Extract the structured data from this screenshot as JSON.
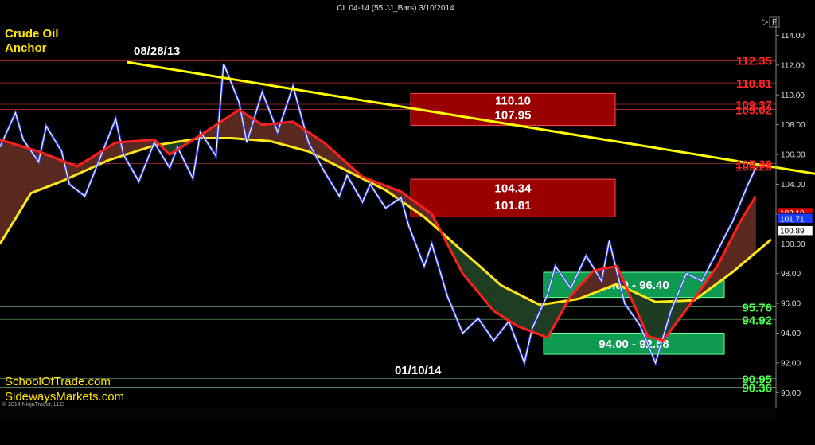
{
  "window": {
    "title": "CL 04-14 (55 JJ_Bars)  3/10/2014",
    "copyright": "© 2014 NinjaTrader, LLC",
    "menu_glyphs": [
      "▷|",
      "F"
    ]
  },
  "overlay": {
    "heading_line1": "Crude Oil",
    "heading_line2": "Anchor",
    "anchor_date": "08/28/13",
    "low_date": "01/10/14",
    "site1": "SchoolOfTrade.com",
    "site2": "SidewaysMarkets.com"
  },
  "colors": {
    "background": "#000000",
    "price": "#ffffff",
    "fast_ma": "#ff1f1f",
    "slow_ma": "#ffe81a",
    "trendline": "#ffff00",
    "resistance_zone": "#9a0000",
    "support_zone": "#0f9a52",
    "resistance_label": "#ff2626",
    "support_label": "#4dff4d"
  },
  "chart_data": {
    "type": "line",
    "title": "CL 04-14 (55 JJ_Bars)  3/10/2014",
    "ylim": [
      89.0,
      115.2
    ],
    "y_ticks": [
      "114.00",
      "112.00",
      "110.00",
      "108.00",
      "106.00",
      "104.00",
      "102.00",
      "100.00",
      "98.00",
      "96.00",
      "94.00",
      "92.00",
      "90.00"
    ],
    "x_range": [
      0,
      100
    ],
    "series": [
      {
        "role": "price",
        "x": [
          0,
          2,
          3,
          5,
          6,
          8,
          9,
          11,
          13,
          15,
          16,
          18,
          20,
          22,
          23,
          25,
          26,
          28,
          29,
          31,
          32,
          34,
          36,
          38,
          40,
          42,
          44,
          45,
          47,
          48,
          50,
          52,
          53,
          55,
          56,
          58,
          60,
          62,
          64,
          66,
          68,
          69,
          71,
          72,
          74,
          76,
          78,
          79,
          81,
          83,
          85,
          87,
          89,
          91,
          93,
          95,
          97,
          98
        ],
        "values": [
          106.5,
          108.8,
          107.0,
          105.5,
          107.9,
          106.2,
          104.0,
          103.2,
          105.8,
          108.4,
          106.0,
          104.2,
          106.8,
          105.1,
          106.5,
          104.4,
          107.5,
          105.9,
          112.1,
          109.5,
          106.8,
          110.2,
          107.5,
          110.6,
          106.8,
          104.9,
          103.2,
          104.6,
          102.8,
          104.0,
          102.4,
          103.1,
          101.2,
          98.5,
          100.0,
          96.5,
          94.0,
          95.0,
          93.5,
          94.8,
          92.0,
          94.3,
          96.6,
          98.5,
          97.0,
          99.2,
          97.5,
          100.2,
          96.0,
          94.5,
          92.0,
          95.5,
          98.0,
          97.5,
          99.5,
          101.5,
          104.0,
          105.1
        ]
      },
      {
        "role": "fast average",
        "x": [
          0,
          5,
          10,
          15,
          20,
          22,
          26,
          31,
          34,
          38,
          42,
          47,
          52,
          56,
          60,
          64,
          67,
          71,
          74,
          77,
          80,
          84,
          86,
          90,
          93,
          96,
          98
        ],
        "values": [
          107.0,
          106.2,
          105.2,
          106.8,
          107.0,
          106.0,
          107.3,
          109.0,
          108.0,
          108.2,
          106.8,
          104.5,
          103.5,
          102.0,
          98.0,
          95.5,
          94.5,
          93.7,
          96.5,
          98.2,
          98.5,
          93.8,
          93.5,
          96.3,
          98.5,
          101.5,
          103.2
        ]
      },
      {
        "role": "slow average",
        "x": [
          0,
          4,
          8,
          14,
          20,
          26,
          30,
          35,
          40,
          45,
          50,
          55,
          60,
          65,
          70,
          75,
          80,
          85,
          90,
          95,
          100
        ],
        "values": [
          100.0,
          103.4,
          104.2,
          105.6,
          106.6,
          107.1,
          107.1,
          106.9,
          106.2,
          104.9,
          103.6,
          101.8,
          99.5,
          97.2,
          95.9,
          96.3,
          97.3,
          96.1,
          96.2,
          98.1,
          100.3
        ]
      }
    ],
    "trendline": {
      "x": [
        16.5,
        145
      ],
      "values": [
        112.2,
        101.4
      ]
    },
    "zones": [
      {
        "top": 110.1,
        "bottom": 107.95,
        "top_label": "110.10",
        "bottom_label": "107.95",
        "kind": "resistance"
      },
      {
        "top": 104.34,
        "bottom": 101.81,
        "top_label": "104.34",
        "bottom_label": "101.81",
        "kind": "resistance"
      },
      {
        "top": 98.09,
        "bottom": 96.4,
        "label": "98.09 - 96.40",
        "kind": "support"
      },
      {
        "top": 94.0,
        "bottom": 92.58,
        "label": "94.00 - 92.58",
        "kind": "support"
      }
    ],
    "levels": [
      {
        "value": 112.35,
        "label": "112.35",
        "kind": "resistance"
      },
      {
        "value": 110.81,
        "label": "110.81",
        "kind": "resistance"
      },
      {
        "value": 109.37,
        "label": "109.37",
        "kind": "resistance"
      },
      {
        "value": 109.02,
        "label": "109.02",
        "kind": "resistance"
      },
      {
        "value": 105.39,
        "label": "105.39",
        "kind": "resistance"
      },
      {
        "value": 105.23,
        "label": "105.23",
        "kind": "resistance"
      },
      {
        "value": 95.76,
        "label": "95.76",
        "kind": "support"
      },
      {
        "value": 94.92,
        "label": "94.92",
        "kind": "support"
      },
      {
        "value": 90.95,
        "label": "90.95",
        "kind": "support"
      },
      {
        "value": 90.36,
        "label": "90.36",
        "kind": "support"
      }
    ],
    "price_tags": [
      {
        "value": 102.1,
        "label": "102.10",
        "color": "#d40000"
      },
      {
        "value": 101.71,
        "label": "101.71",
        "color": "#1a3cff"
      },
      {
        "value": 100.89,
        "label": "100.89",
        "color": "#ffffff"
      }
    ],
    "annotations": [
      "Crude Oil",
      "Anchor",
      "08/28/13",
      "01/10/14",
      "SchoolOfTrade.com",
      "SidewaysMarkets.com"
    ],
    "grid": false,
    "legend": "none"
  }
}
